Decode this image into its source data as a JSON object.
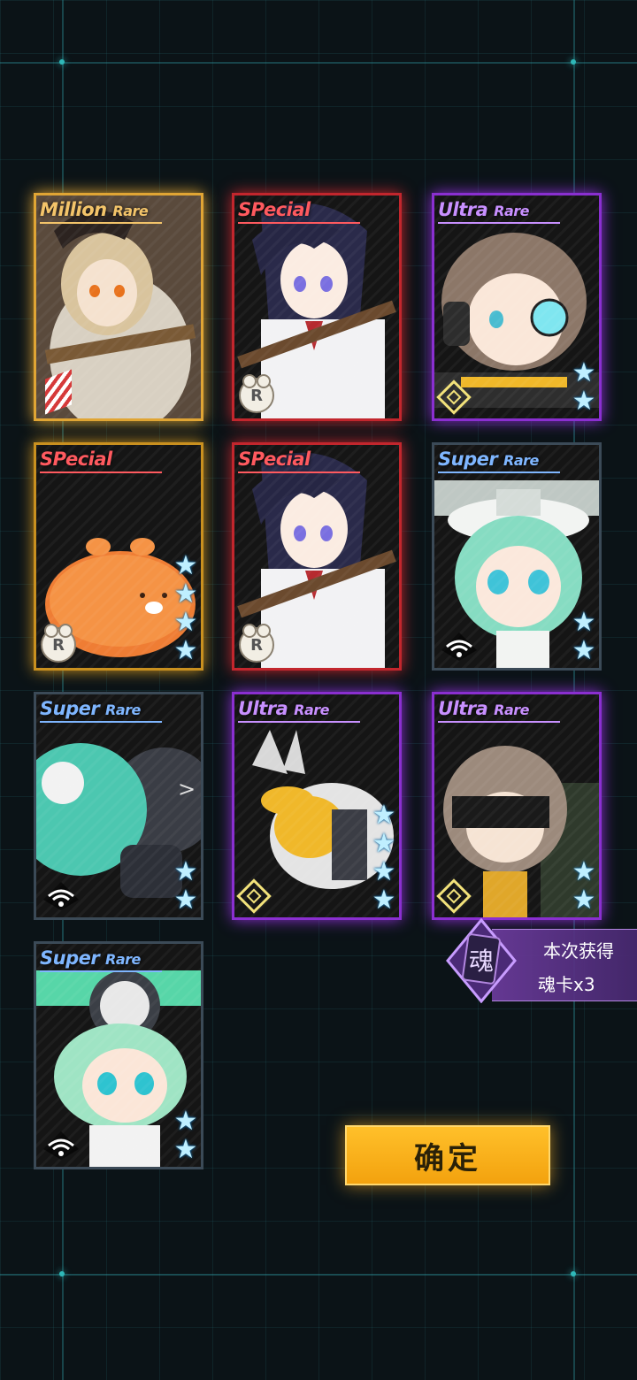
{
  "cards": [
    {
      "rarity_main": "Million",
      "rarity_sub": "Rare",
      "style": "mr",
      "badge": "stripe",
      "stars": 0
    },
    {
      "rarity_main": "SPecial",
      "rarity_sub": "",
      "style": "sp-glow",
      "badge": "R",
      "stars": 0
    },
    {
      "rarity_main": "Ultra",
      "rarity_sub": "Rare",
      "style": "ur",
      "badge": "diamond",
      "stars": 2
    },
    {
      "rarity_main": "SPecial",
      "rarity_sub": "",
      "style": "sp-gold",
      "badge": "R",
      "stars": 4
    },
    {
      "rarity_main": "SPecial",
      "rarity_sub": "",
      "style": "sp-glow",
      "badge": "R",
      "stars": 0
    },
    {
      "rarity_main": "Super",
      "rarity_sub": "Rare",
      "style": "sr",
      "badge": "wifi",
      "stars": 2
    },
    {
      "rarity_main": "Super",
      "rarity_sub": "Rare",
      "style": "sr",
      "badge": "wifi",
      "stars": 2
    },
    {
      "rarity_main": "Ultra",
      "rarity_sub": "Rare",
      "style": "ur",
      "badge": "diamond",
      "stars": 4
    },
    {
      "rarity_main": "Ultra",
      "rarity_sub": "Rare",
      "style": "ur",
      "badge": "diamond",
      "stars": 2
    },
    {
      "rarity_main": "Super",
      "rarity_sub": "Rare",
      "style": "sr",
      "badge": "wifi",
      "stars": 2
    }
  ],
  "badge_r_label": "R",
  "soul": {
    "icon_char": "魂",
    "line1": "本次获得",
    "line2": "魂卡x3"
  },
  "confirm_label": "确定",
  "colors": {
    "million_rare": "#e0a534",
    "special": "#c2262d",
    "ultra_rare": "#8a2fd0",
    "super_rare": "#3b4a57",
    "button": "#ffc02a"
  }
}
